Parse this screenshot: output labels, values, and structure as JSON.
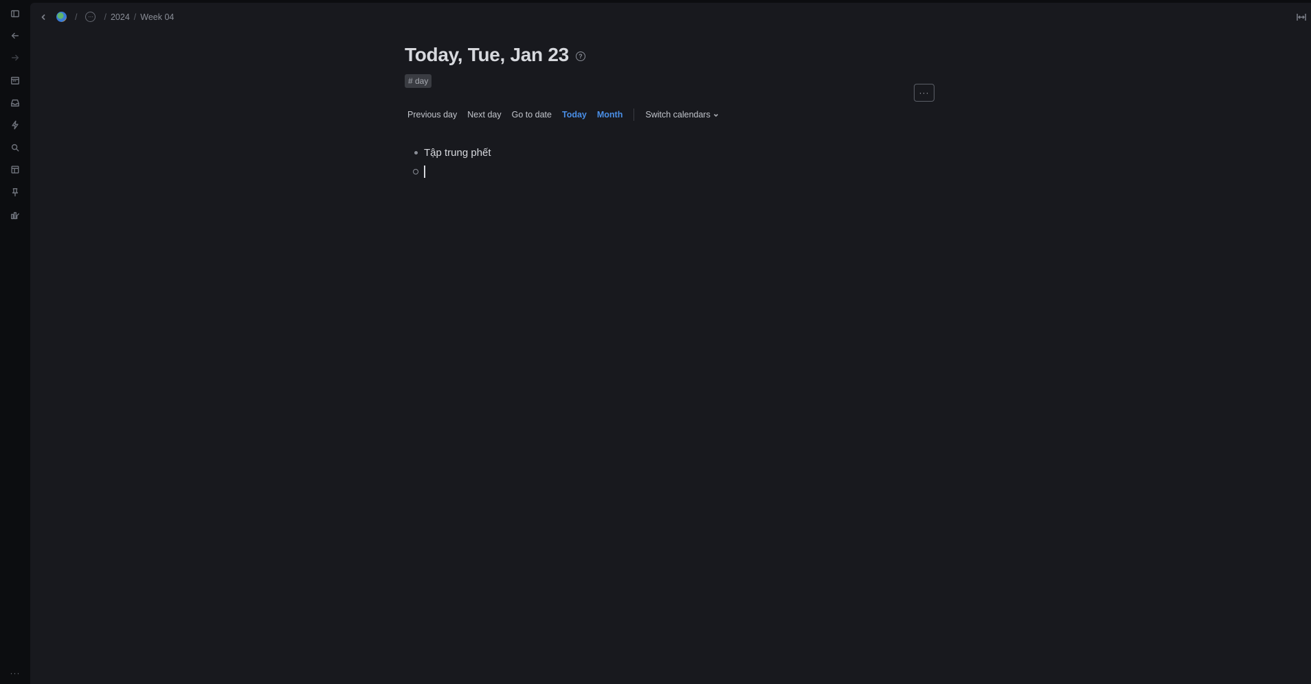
{
  "rail": {
    "icons": [
      "sidebar-toggle-icon",
      "arrow-left-icon",
      "arrow-right-icon",
      "calendar-icon",
      "inbox-icon",
      "lightning-icon",
      "search-icon",
      "layout-icon",
      "pin-icon",
      "graph-icon"
    ],
    "more_label": "···"
  },
  "breadcrumb": {
    "items": [
      "2024",
      "Week 04"
    ],
    "separator": "/",
    "dots_label": "···"
  },
  "page": {
    "title": "Today, Tue, Jan 23",
    "help_label": "?",
    "tag": "# day",
    "more_label": "···"
  },
  "nav": {
    "previous_day": "Previous day",
    "next_day": "Next day",
    "go_to_date": "Go to date",
    "today": "Today",
    "month": "Month",
    "switch_calendars": "Switch calendars"
  },
  "blocks": [
    {
      "text": "Tập trung phết"
    },
    {
      "text": ""
    }
  ],
  "colors": {
    "accent": "#4a8fe7",
    "background": "#18191e",
    "rail": "#0c0d10"
  }
}
